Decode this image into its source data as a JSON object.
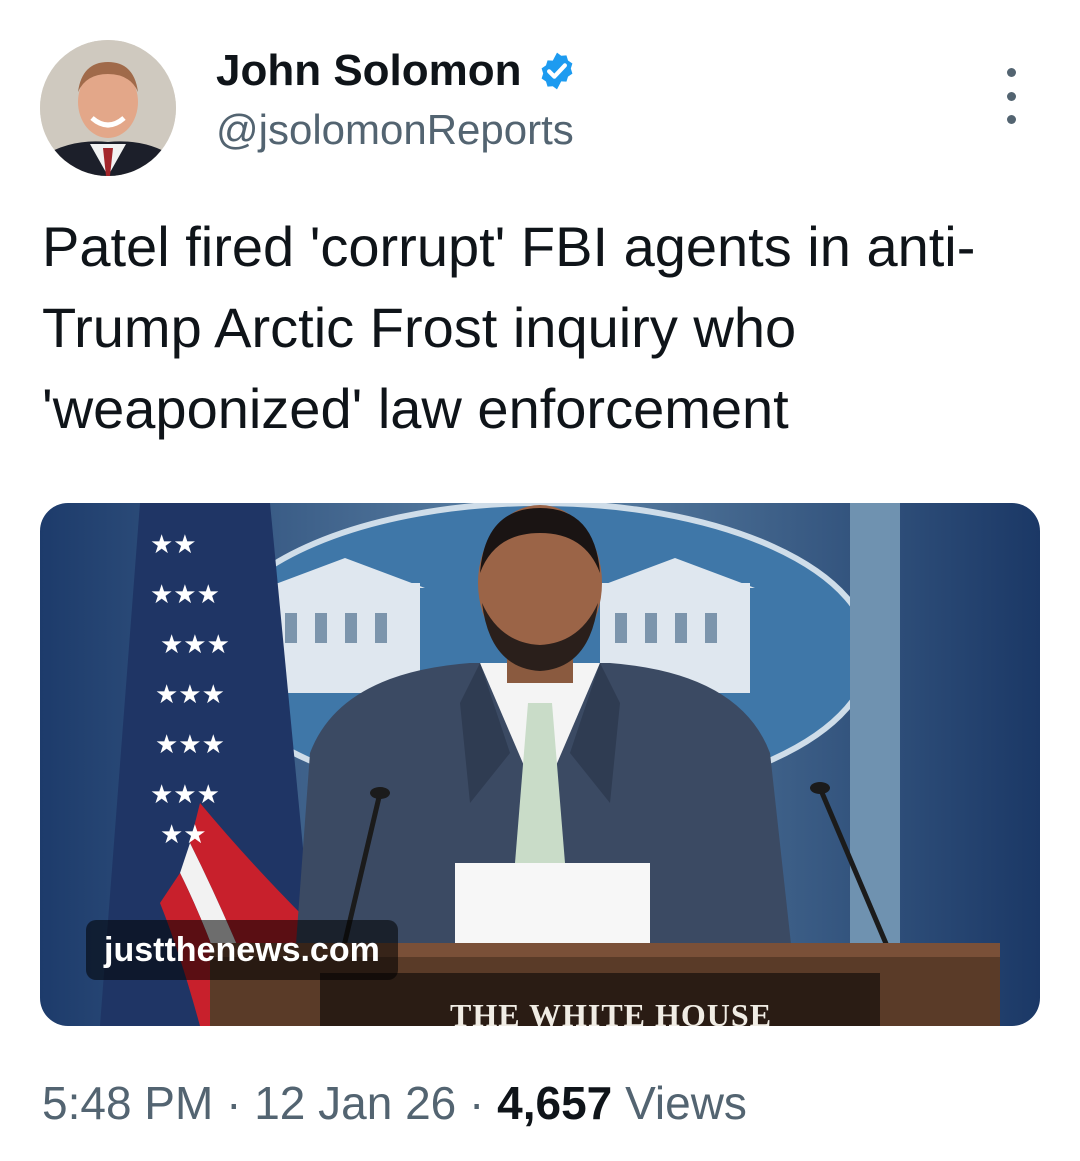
{
  "author": {
    "name": "John Solomon",
    "handle": "@jsolomonReports",
    "verified_badge_icon": "verified-check-icon",
    "accent_color": "#1d9bf0"
  },
  "more_icon": "more-vertical-icon",
  "tweet": {
    "text": "Patel fired 'corrupt' FBI agents in anti-Trump Arctic Frost inquiry who 'weaponized' law enforcement"
  },
  "media": {
    "source_label": "justthenews.com",
    "podium_text": "THE WHITE HOUSE"
  },
  "meta": {
    "time": "5:48 PM",
    "separator": "·",
    "date": "12 Jan 26",
    "views_count": "4,657",
    "views_label": "Views"
  }
}
